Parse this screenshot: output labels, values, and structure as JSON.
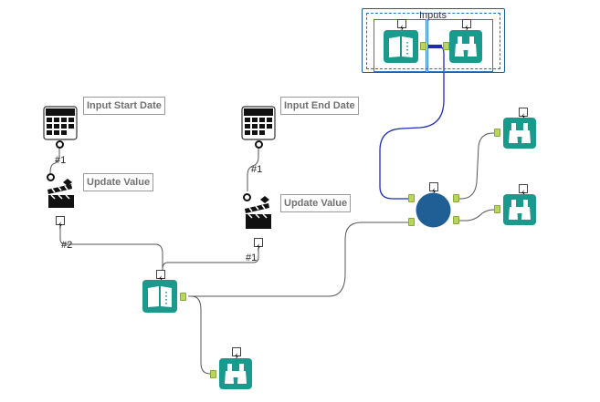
{
  "labels": {
    "input_start_date": "Input Start Date",
    "input_end_date": "Input End Date",
    "update_value_left": "Update Value",
    "update_value_right": "Update Value"
  },
  "container": {
    "title": "Inputs"
  },
  "connection_labels": {
    "start_date_to_update": "#1",
    "update_left_out": "#2",
    "end_date_to_update": "#1",
    "update_right_out": "#1"
  },
  "icons": {
    "date": "calendar-icon",
    "action": "clapperboard-icon",
    "text_input": "text-input-book-icon",
    "browse": "binoculars-icon",
    "macro": "macro-circle-icon",
    "lightning": "lightning-bolt-icon",
    "question": "question-anchor-icon"
  },
  "colors": {
    "tool_teal": "#1a9a8c",
    "macro_blue": "#1f5f96",
    "anchor_green": "#b8d65a",
    "wire": "#555555",
    "wire_selected": "#1f2bb8"
  }
}
